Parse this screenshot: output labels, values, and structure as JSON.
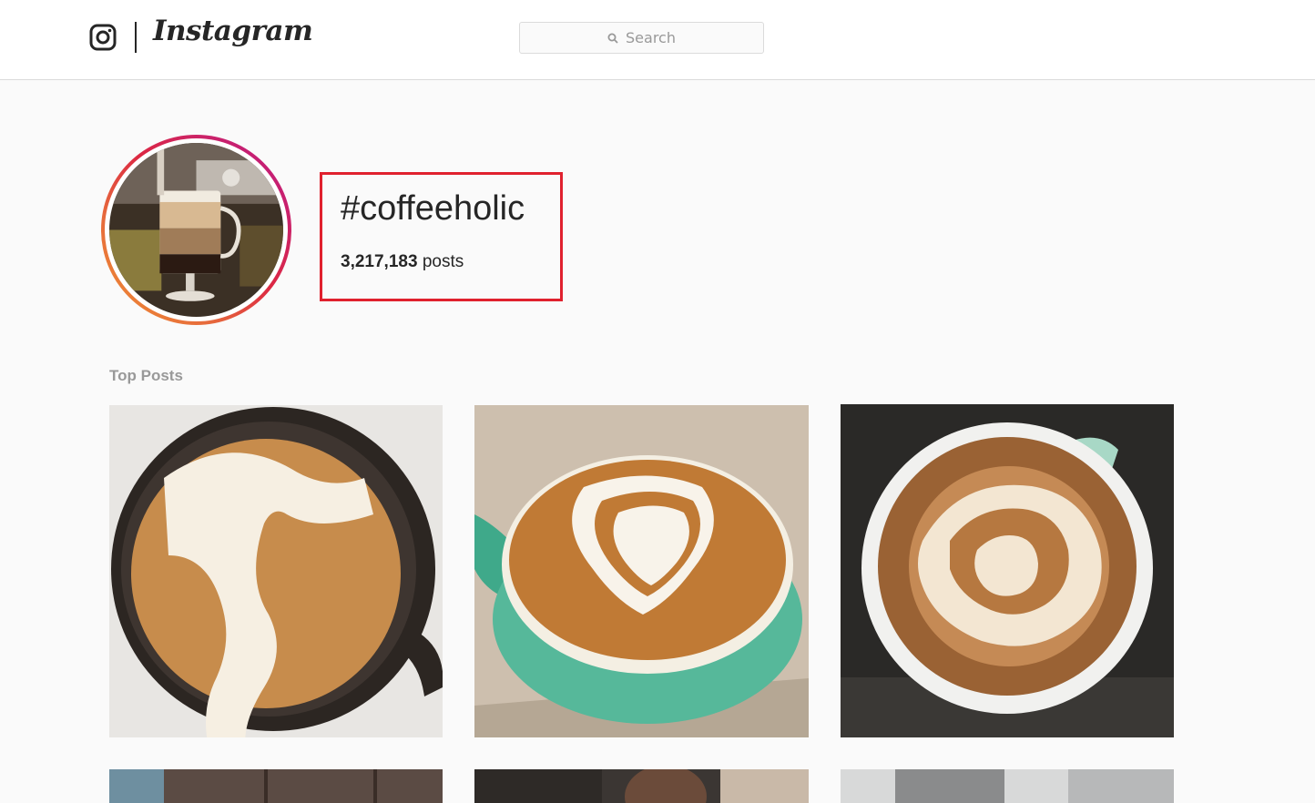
{
  "header": {
    "logo_text": "Instagram",
    "search": {
      "placeholder": "Search"
    }
  },
  "hashtag": {
    "title": "#coffeeholic",
    "post_count": "3,217,183",
    "post_label": "posts"
  },
  "sections": {
    "top_posts_label": "Top Posts"
  },
  "posts": [
    {
      "subject": "cappuccino with foam pour art, top view"
    },
    {
      "subject": "latte heart tulip art in green cup"
    },
    {
      "subject": "latte art tiger in white cup"
    },
    {
      "subject": "partial post (cut off)"
    },
    {
      "subject": "partial post (cut off)"
    },
    {
      "subject": "partial post (cut off)"
    }
  ],
  "colors": {
    "highlight_box": "#e0212e",
    "border": "#dbdbdb",
    "muted_text": "#999999",
    "text": "#262626"
  }
}
